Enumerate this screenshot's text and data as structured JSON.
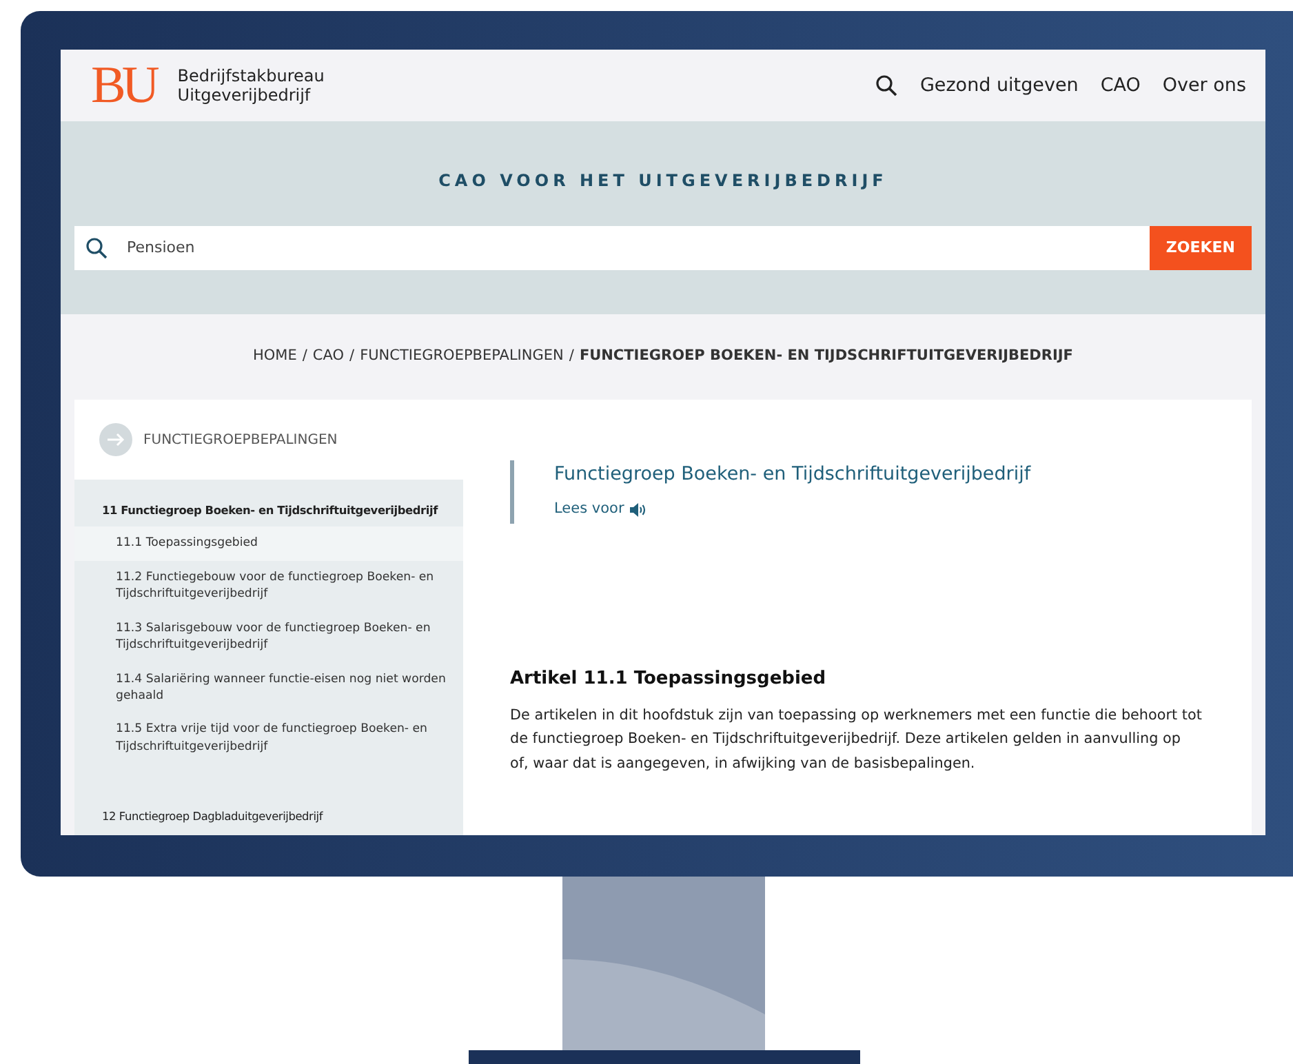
{
  "header": {
    "logo": "BU",
    "brand_lines": [
      "Bedrijfstakbureau",
      "Uitgeverijbedrijf"
    ],
    "nav": [
      "Gezond uitgeven",
      "CAO",
      "Over ons"
    ]
  },
  "hero": {
    "title": "CAO VOOR HET UITGEVERIJBEDRIJF",
    "search": {
      "value": "Pensioen"
    },
    "search_button": "ZOEKEN"
  },
  "breadcrumb": {
    "separator": "/",
    "items": [
      {
        "label": "HOME",
        "current": false
      },
      {
        "label": "CAO",
        "current": false
      },
      {
        "label": "FUNCTIEGROEPBEPALINGEN",
        "current": false
      },
      {
        "label": "FUNCTIEGROEP BOEKEN- EN TIJDSCHRIFTUITGEVERIJBEDRIJF",
        "current": true
      }
    ]
  },
  "sidebar": {
    "heading": "FUNCTIEGROEPBEPALINGEN",
    "items": [
      {
        "label": "11 Functiegroep Boeken- en Tijdschriftuitgeverijbedrijf",
        "expanded": true,
        "children": [
          {
            "label": "11.1 Toepassingsgebied",
            "selected": true
          },
          {
            "label": "11.2 Functiegebouw voor de functiegroep Boeken- en Tijdschriftuitgeverijbedrijf",
            "selected": false
          },
          {
            "label": "11.3 Salarisgebouw voor de functiegroep Boeken- en Tijdschriftuitgeverijbedrijf",
            "selected": false
          },
          {
            "label": "11.4 Salariëring wanneer functie-eisen nog niet worden gehaald",
            "selected": false
          },
          {
            "label": "11.5 Extra vrije tijd voor de functiegroep Boeken- en Tijdschriftuitgeverijbedrijf",
            "selected": false
          }
        ]
      },
      {
        "label": "12 Functiegroep Dagbladuitgeverijbedrijf",
        "expanded": false
      }
    ]
  },
  "article": {
    "title": "Functiegroep Boeken- en Tijdschriftuitgeverijbedrijf",
    "read_aloud": "Lees voor",
    "heading": "Artikel 11.1 Toepassingsgebied",
    "body": "De artikelen in dit hoofdstuk zijn van toepassing op werknemers met een functie die behoort tot de functiegroep Boeken- en Tijdschriftuitgeverijbedrijf. Deze artikelen gelden in aanvulling op of, waar dat is aangegeven, in afwijking van de basisbepalingen."
  }
}
